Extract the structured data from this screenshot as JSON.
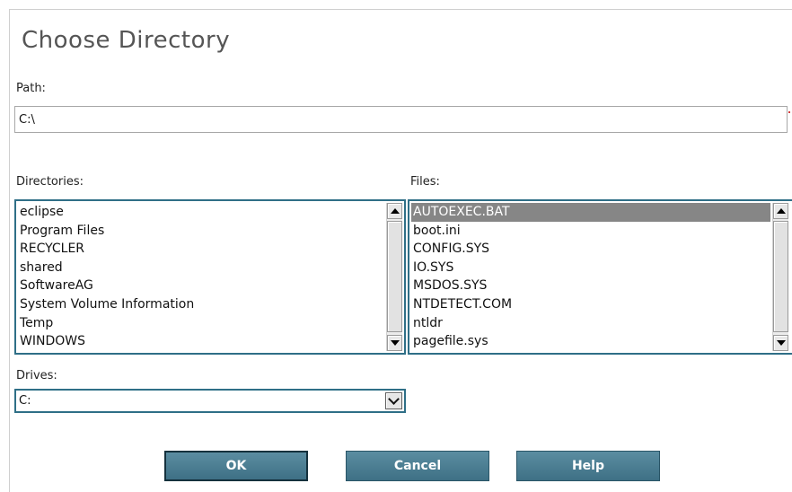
{
  "dialog": {
    "title": "Choose Directory"
  },
  "path": {
    "label": "Path:",
    "value": "C:\\"
  },
  "directories": {
    "label": "Directories:",
    "items": [
      "eclipse",
      "Program Files",
      "RECYCLER",
      "shared",
      "SoftwareAG",
      "System Volume Information",
      "Temp",
      "WINDOWS"
    ]
  },
  "files": {
    "label": "Files:",
    "items": [
      "AUTOEXEC.BAT",
      "boot.ini",
      "CONFIG.SYS",
      "IO.SYS",
      "MSDOS.SYS",
      "NTDETECT.COM",
      "ntldr",
      "pagefile.sys"
    ],
    "selected": "AUTOEXEC.BAT"
  },
  "drives": {
    "label": "Drives:",
    "value": "C:"
  },
  "buttons": {
    "ok": "OK",
    "cancel": "Cancel",
    "help": "Help"
  },
  "colors": {
    "accent": "#2f6f87",
    "button": "#4a7c91",
    "selection": "#868686",
    "title": "#555555"
  },
  "icons": [
    "scroll-up-icon",
    "scroll-down-icon",
    "dropdown-arrow-icon"
  ]
}
